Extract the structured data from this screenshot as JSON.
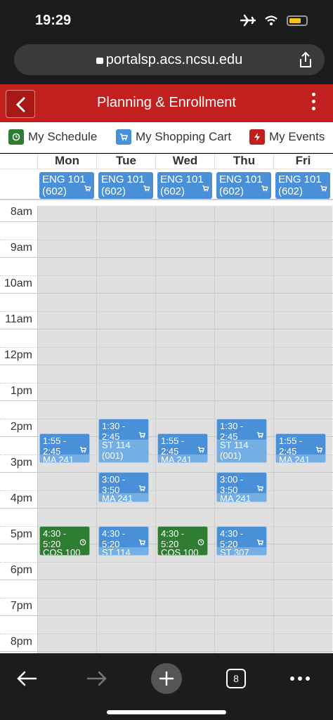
{
  "status": {
    "time": "19:29"
  },
  "browser": {
    "url": "portalsp.acs.ncsu.edu",
    "tabs_count": "8"
  },
  "app": {
    "title": "Planning & Enrollment"
  },
  "legend": [
    {
      "label": "My Schedule",
      "color": "#2e7d32"
    },
    {
      "label": "My Shopping Cart",
      "color": "#4a90d9"
    },
    {
      "label": "My Events",
      "color": "#c1201f"
    }
  ],
  "days": [
    "Mon",
    "Tue",
    "Wed",
    "Thu",
    "Fri"
  ],
  "allday": [
    {
      "line1": "ENG 101",
      "line2": "(602)"
    },
    {
      "line1": "ENG 101",
      "line2": "(602)"
    },
    {
      "line1": "ENG 101",
      "line2": "(602)"
    },
    {
      "line1": "ENG 101",
      "line2": "(602)"
    },
    {
      "line1": "ENG 101",
      "line2": "(602)"
    }
  ],
  "hours": [
    "8am",
    "9am",
    "10am",
    "11am",
    "12pm",
    "1pm",
    "2pm",
    "3pm",
    "4pm",
    "5pm",
    "6pm",
    "7pm",
    "8pm"
  ],
  "events": [
    {
      "day": 0,
      "time": "1:55 - 2:45",
      "course": "MA 241",
      "type": "cart"
    },
    {
      "day": 0,
      "time": "4:30 - 5:20",
      "course": "COS 100",
      "type": "sched"
    },
    {
      "day": 1,
      "time": "1:30 - 2:45",
      "course": "ST 114",
      "section": "(001)",
      "type": "cart"
    },
    {
      "day": 1,
      "time": "3:00 - 3:50",
      "course": "MA 241",
      "type": "cart"
    },
    {
      "day": 1,
      "time": "4:30 - 5:20",
      "course": "ST 114",
      "type": "cart"
    },
    {
      "day": 2,
      "time": "1:55 - 2:45",
      "course": "MA 241",
      "type": "cart"
    },
    {
      "day": 2,
      "time": "4:30 - 5:20",
      "course": "COS 100",
      "type": "sched"
    },
    {
      "day": 3,
      "time": "1:30 - 2:45",
      "course": "ST 114",
      "section": "(001)",
      "type": "cart"
    },
    {
      "day": 3,
      "time": "3:00 - 3:50",
      "course": "MA 241",
      "type": "cart"
    },
    {
      "day": 3,
      "time": "4:30 - 5:20",
      "course": "ST 307",
      "type": "cart"
    },
    {
      "day": 4,
      "time": "1:55 - 2:45",
      "course": "MA 241",
      "type": "cart"
    }
  ]
}
